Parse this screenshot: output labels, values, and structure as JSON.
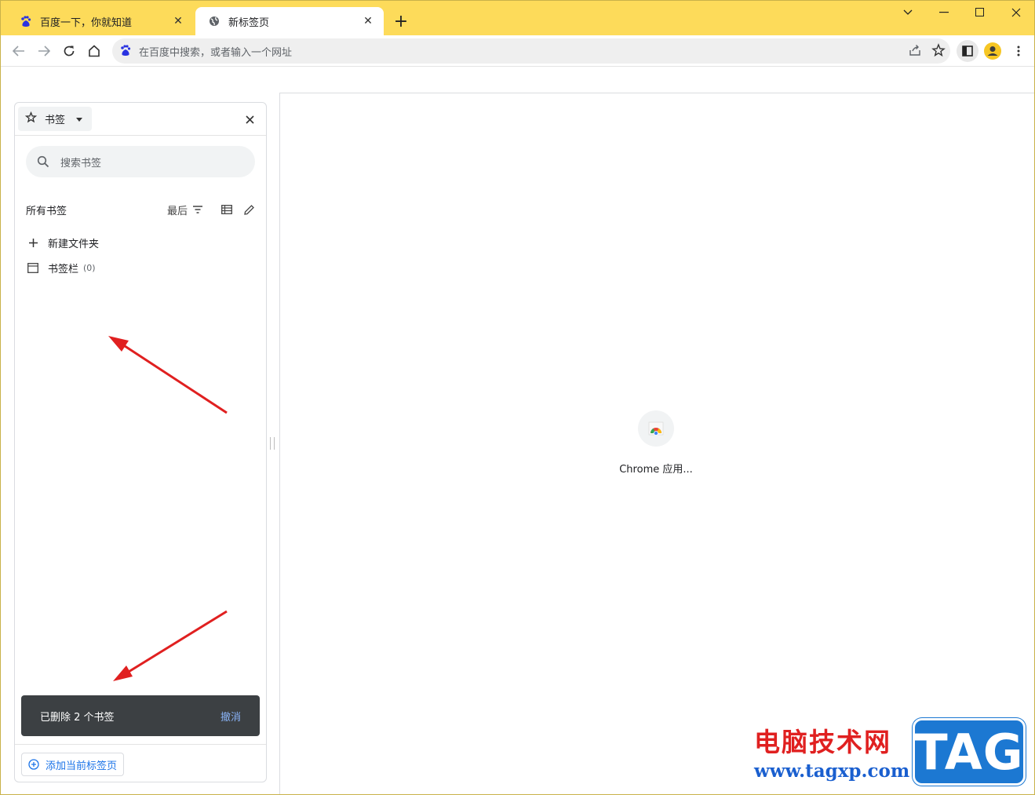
{
  "tabs": [
    {
      "title": "百度一下，你就知道",
      "favicon": "baidu-icon",
      "active": false
    },
    {
      "title": "新标签页",
      "favicon": "globe-icon",
      "active": true
    }
  ],
  "toolbar": {
    "omnibox_placeholder": "在百度中搜索，或者输入一个网址"
  },
  "side_panel": {
    "selector_label": "书签",
    "search_placeholder": "搜索书签",
    "section_title": "所有书签",
    "sort_label": "最后",
    "items": [
      {
        "label": "新建文件夹",
        "icon": "plus-icon",
        "count": ""
      },
      {
        "label": "书签栏",
        "icon": "folder-icon",
        "count": "(0)"
      }
    ],
    "toast": {
      "message": "已删除 2 个书签",
      "action": "撤消"
    },
    "add_current_tab": "添加当前标签页"
  },
  "content": {
    "shortcut_label": "Chrome 应用..."
  },
  "watermark": {
    "cn": "电脑技术网",
    "url": "www.tagxp.com",
    "tag": "TAG"
  },
  "colors": {
    "tabstrip": "#fddb5a",
    "annotation_arrow": "#e02020",
    "toast_bg": "#3c4043",
    "link_blue": "#1a73e8"
  }
}
